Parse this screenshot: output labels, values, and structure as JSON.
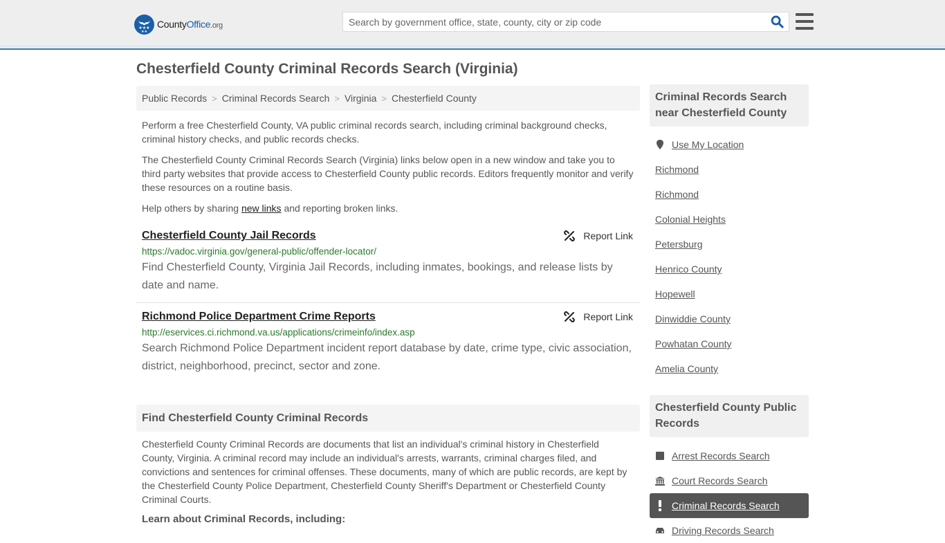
{
  "header": {
    "logo": {
      "name_part1": "County",
      "name_part2": "Office",
      "name_part3": ".org"
    },
    "search": {
      "placeholder": "Search by government office, state, county, city or zip code",
      "value": ""
    },
    "icons": {
      "search": "search-icon",
      "menu": "hamburger-menu-icon"
    }
  },
  "page": {
    "title": "Chesterfield County Criminal Records Search (Virginia)"
  },
  "breadcrumb": [
    {
      "label": "Public Records"
    },
    {
      "label": "Criminal Records Search"
    },
    {
      "label": "Virginia"
    },
    {
      "label": "Chesterfield County"
    }
  ],
  "breadcrumb_separator": ">",
  "intro": {
    "p1": "Perform a free Chesterfield County, VA public criminal records search, including criminal background checks, criminal history checks, and public records checks.",
    "p2": "The Chesterfield County Criminal Records Search (Virginia) links below open in a new window and take you to third party websites that provide access to Chesterfield County public records. Editors frequently monitor and verify these resources on a routine basis.",
    "p3_before": "Help others by sharing ",
    "p3_link": "new links",
    "p3_after": " and reporting broken links."
  },
  "results": [
    {
      "title": "Chesterfield County Jail Records",
      "url": "https://vadoc.virginia.gov/general-public/offender-locator/",
      "description": "Find Chesterfield County, Virginia Jail Records, including inmates, bookings, and release lists by date and name.",
      "report_label": "Report Link"
    },
    {
      "title": "Richmond Police Department Crime Reports",
      "url": "http://eservices.ci.richmond.va.us/applications/crimeinfo/index.asp",
      "description": "Search Richmond Police Department incident report database by date, crime type, civic association, district, neighborhood, precinct, sector and zone.",
      "report_label": "Report Link"
    }
  ],
  "find_section": {
    "heading": "Find Chesterfield County Criminal Records",
    "body": "Chesterfield County Criminal Records are documents that list an individual's criminal history in Chesterfield County, Virginia. A criminal record may include an individual's arrests, warrants, criminal charges filed, and convictions and sentences for criminal offenses. These documents, many of which are public records, are kept by the Chesterfield County Police Department, Chesterfield County Sheriff's Department or Chesterfield County Criminal Courts.",
    "learn_heading": "Learn about Criminal Records, including:"
  },
  "sidebar": {
    "near_heading": "Criminal Records Search near Chesterfield County",
    "use_location": "Use My Location",
    "near_items": [
      {
        "label": "Richmond"
      },
      {
        "label": "Richmond"
      },
      {
        "label": "Colonial Heights"
      },
      {
        "label": "Petersburg"
      },
      {
        "label": "Henrico County"
      },
      {
        "label": "Hopewell"
      },
      {
        "label": "Dinwiddie County"
      },
      {
        "label": "Powhatan County"
      },
      {
        "label": "Amelia County"
      }
    ],
    "public_heading": "Chesterfield County Public Records",
    "public_items": [
      {
        "label": "Arrest Records Search",
        "icon": "square-icon",
        "active": false
      },
      {
        "label": "Court Records Search",
        "icon": "courthouse-icon",
        "active": false
      },
      {
        "label": "Criminal Records Search",
        "icon": "exclamation-icon",
        "active": true
      },
      {
        "label": "Driving Records Search",
        "icon": "car-icon",
        "active": false
      }
    ]
  },
  "colors": {
    "brand_blue": "#1a5fa8",
    "header_border": "#3d7aa9",
    "url_green": "#2a7a2a",
    "active_bg": "#555555"
  }
}
